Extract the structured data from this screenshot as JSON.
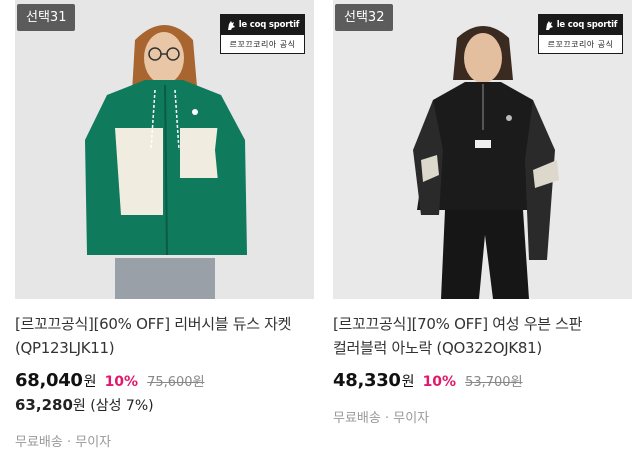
{
  "products": [
    {
      "badge": "선택31",
      "brand_logo_text": "le coq sportif",
      "brand_logo_sub": "르꼬끄코리아 공식",
      "title": "[르꼬끄공식][60% OFF] 리버시블 듀스 자켓(QP123LJK11)",
      "price": "68,040",
      "currency": "원",
      "discount_rate": "10%",
      "original_price": "75,600원",
      "card_price": "63,280",
      "card_price_note": "(삼성 7%)",
      "shipping_tags": "무료배송 · 무이자",
      "image_colors": {
        "primary": "#0f7a5c",
        "secondary": "#f1ece0",
        "background": "#e6e6e6"
      }
    },
    {
      "badge": "선택32",
      "brand_logo_text": "le coq sportif",
      "brand_logo_sub": "르꼬끄코리아 공식",
      "title": "[르꼬끄공식][70% OFF] 여성 우븐 스판 컬러블럭 아노락 (QO322OJK81)",
      "price": "48,330",
      "currency": "원",
      "discount_rate": "10%",
      "original_price": "53,700원",
      "shipping_tags": "무료배송 · 무이자",
      "image_colors": {
        "primary": "#1b1b1b",
        "secondary": "#ddd8cc",
        "background": "#e9e9e9"
      }
    }
  ],
  "colors": {
    "discount": "#e0196d",
    "badge_bg": "#484848",
    "muted_text": "#999999"
  }
}
